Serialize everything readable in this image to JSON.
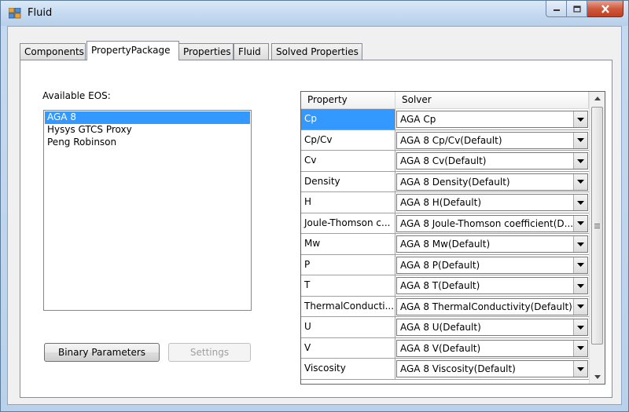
{
  "window": {
    "title": "Fluid"
  },
  "tabs": [
    {
      "label": "Components"
    },
    {
      "label": "PropertyPackage"
    },
    {
      "label": "Properties"
    },
    {
      "label": "Fluid"
    },
    {
      "label": "Solved Properties"
    }
  ],
  "active_tab": "PropertyPackage",
  "eos": {
    "label": "Available EOS:",
    "items": [
      "AGA 8",
      "Hysys GTCS Proxy",
      "Peng Robinson"
    ],
    "selected": "AGA 8"
  },
  "buttons": {
    "binary_parameters": "Binary Parameters",
    "settings": "Settings"
  },
  "grid": {
    "headers": {
      "property": "Property",
      "solver": "Solver"
    },
    "rows": [
      {
        "property": "Cp",
        "solver": "AGA Cp"
      },
      {
        "property": "Cp/Cv",
        "solver": "AGA 8 Cp/Cv(Default)"
      },
      {
        "property": "Cv",
        "solver": "AGA 8 Cv(Default)"
      },
      {
        "property": "Density",
        "solver": "AGA 8 Density(Default)"
      },
      {
        "property": "H",
        "solver": "AGA 8 H(Default)"
      },
      {
        "property": "Joule-Thomson c...",
        "solver": "AGA 8 Joule-Thomson coefficient(D..."
      },
      {
        "property": "Mw",
        "solver": "AGA 8 Mw(Default)"
      },
      {
        "property": "P",
        "solver": "AGA 8 P(Default)"
      },
      {
        "property": "T",
        "solver": "AGA 8 T(Default)"
      },
      {
        "property": "ThermalConducti...",
        "solver": "AGA 8 ThermalConductivity(Default)"
      },
      {
        "property": "U",
        "solver": "AGA 8 U(Default)"
      },
      {
        "property": "V",
        "solver": "AGA 8 V(Default)"
      },
      {
        "property": "Viscosity",
        "solver": "AGA 8 Viscosity(Default)"
      }
    ],
    "selected_row": 0
  },
  "colors": {
    "selection": "#3399ff",
    "close_button": "#c94a2e"
  }
}
